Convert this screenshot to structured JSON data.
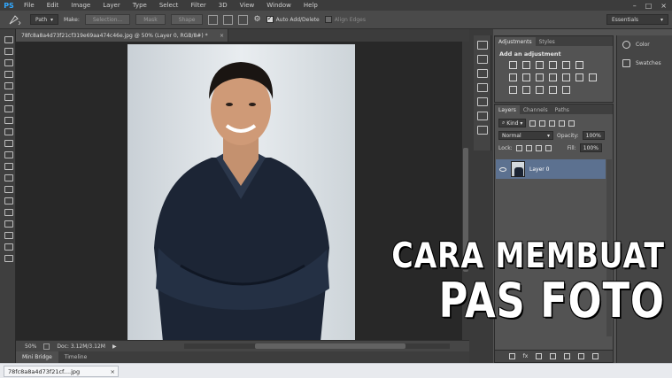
{
  "app": {
    "logo": "PS",
    "menu": [
      "File",
      "Edit",
      "Image",
      "Layer",
      "Type",
      "Select",
      "Filter",
      "3D",
      "View",
      "Window",
      "Help"
    ]
  },
  "options_bar": {
    "mode": "Path",
    "make_label": "Make:",
    "selection_btn": "Selection...",
    "mask_btn": "Mask",
    "shape_btn": "Shape",
    "auto_add_delete": "Auto Add/Delete",
    "auto_add_delete_checked": true,
    "align_edges": "Align Edges",
    "align_edges_checked": false,
    "workspace": "Essentials"
  },
  "document": {
    "tab_title": "78fc8a8a4d73f21cf319e69aa474c46e.jpg @ 50% (Layer 0, RGB/8#) *",
    "zoom": "50%",
    "doc_size": "Doc: 3.12M/3.12M"
  },
  "bottom_tabs": [
    "Mini Bridge",
    "Timeline"
  ],
  "taskbar": {
    "file_label": "78fc8a8a4d73f21cf....jpg"
  },
  "adjustments": {
    "tabs": [
      "Adjustments",
      "Styles"
    ],
    "title": "Add an adjustment"
  },
  "side_panels": {
    "color": "Color",
    "swatches": "Swatches"
  },
  "layers": {
    "tabs": [
      "Layers",
      "Channels",
      "Paths"
    ],
    "kind_filter": "Kind",
    "blend_mode": "Normal",
    "opacity_label": "Opacity:",
    "opacity_value": "100%",
    "lock_label": "Lock:",
    "fill_label": "Fill:",
    "fill_value": "100%",
    "layer_name": "Layer 0"
  },
  "overlay": {
    "line1": "CARA MEMBUAT",
    "line2": "PAS FOTO"
  },
  "colors": {
    "foreground": "#ff1e1e",
    "background": "#ffffff",
    "selected_layer": "#5c7190"
  }
}
